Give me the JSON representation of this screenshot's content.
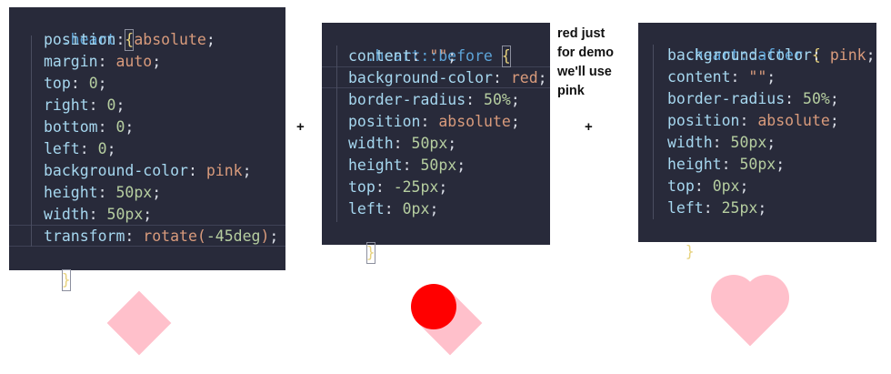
{
  "panels": {
    "heart": {
      "selector": ".heart",
      "open_brace": "{",
      "close_brace": "}",
      "declarations": [
        {
          "prop": "position",
          "value": "absolute",
          "kind": "kw"
        },
        {
          "prop": "margin",
          "value": "auto",
          "kind": "kw"
        },
        {
          "prop": "top",
          "value": "0",
          "kind": "num"
        },
        {
          "prop": "right",
          "value": "0",
          "kind": "num"
        },
        {
          "prop": "bottom",
          "value": "0",
          "kind": "num"
        },
        {
          "prop": "left",
          "value": "0",
          "kind": "num"
        },
        {
          "prop": "background-color",
          "value": "pink",
          "kind": "kw"
        },
        {
          "prop": "height",
          "value": "50px",
          "kind": "num"
        },
        {
          "prop": "width",
          "value": "50px",
          "kind": "num"
        },
        {
          "prop": "transform",
          "value_fn": "rotate(",
          "value_arg": "-45deg",
          "value_close": ")",
          "kind": "fn"
        }
      ]
    },
    "before": {
      "selector": ".heart::before",
      "open_brace": "{",
      "close_brace": "}",
      "declarations": [
        {
          "prop": "content",
          "value": "\"\"",
          "kind": "kw"
        },
        {
          "prop": "background-color",
          "value": "red",
          "kind": "kw"
        },
        {
          "prop": "border-radius",
          "value": "50%",
          "kind": "num"
        },
        {
          "prop": "position",
          "value": "absolute",
          "kind": "kw"
        },
        {
          "prop": "width",
          "value": "50px",
          "kind": "num"
        },
        {
          "prop": "height",
          "value": "50px",
          "kind": "num"
        },
        {
          "prop": "top",
          "value": "-25px",
          "kind": "num"
        },
        {
          "prop": "left",
          "value": "0px",
          "kind": "num"
        }
      ]
    },
    "after": {
      "selector": ".heart::after",
      "open_brace": "{",
      "close_brace": "}",
      "declarations": [
        {
          "prop": "background-color",
          "value": "pink",
          "kind": "kw"
        },
        {
          "prop": "content",
          "value": "\"\"",
          "kind": "kw"
        },
        {
          "prop": "border-radius",
          "value": "50%",
          "kind": "num"
        },
        {
          "prop": "position",
          "value": "absolute",
          "kind": "kw"
        },
        {
          "prop": "width",
          "value": "50px",
          "kind": "num"
        },
        {
          "prop": "height",
          "value": "50px",
          "kind": "num"
        },
        {
          "prop": "top",
          "value": "0px",
          "kind": "num"
        },
        {
          "prop": "left",
          "value": "25px",
          "kind": "num"
        }
      ]
    }
  },
  "operators": {
    "plus_1": "+",
    "plus_2": "+"
  },
  "note": [
    "red just",
    "for demo",
    "we'll use",
    "pink"
  ],
  "colors": {
    "editor_bg": "#282a3a",
    "pink": "#ffc0cb",
    "red": "#ff0000"
  }
}
